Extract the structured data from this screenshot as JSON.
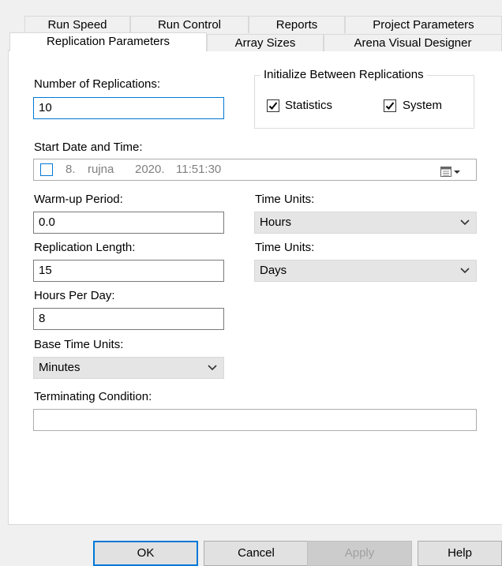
{
  "tabs_back": [
    "Run Speed",
    "Run Control",
    "Reports",
    "Project Parameters"
  ],
  "tabs_front": [
    "Replication Parameters",
    "Array Sizes",
    "Arena Visual Designer"
  ],
  "form": {
    "num_replications_label": "Number of Replications:",
    "num_replications_value": "10",
    "init_group_title": "Initialize Between Replications",
    "statistics_label": "Statistics",
    "statistics_checked": true,
    "system_label": "System",
    "system_checked": true,
    "start_date_label": "Start Date and Time:",
    "start_date_day": "8.",
    "start_date_month": "rujna",
    "start_date_year": "2020.",
    "start_date_time": "11:51:30",
    "warmup_label": "Warm-up Period:",
    "warmup_value": "0.0",
    "warmup_units_label": "Time Units:",
    "warmup_units_value": "Hours",
    "rep_length_label": "Replication Length:",
    "rep_length_value": "15",
    "rep_length_units_label": "Time Units:",
    "rep_length_units_value": "Days",
    "hours_per_day_label": "Hours Per Day:",
    "hours_per_day_value": "8",
    "base_time_units_label": "Base Time Units:",
    "base_time_units_value": "Minutes",
    "terminating_label": "Terminating Condition:",
    "terminating_value": ""
  },
  "buttons": {
    "ok": "OK",
    "cancel": "Cancel",
    "apply": "Apply",
    "help": "Help"
  }
}
